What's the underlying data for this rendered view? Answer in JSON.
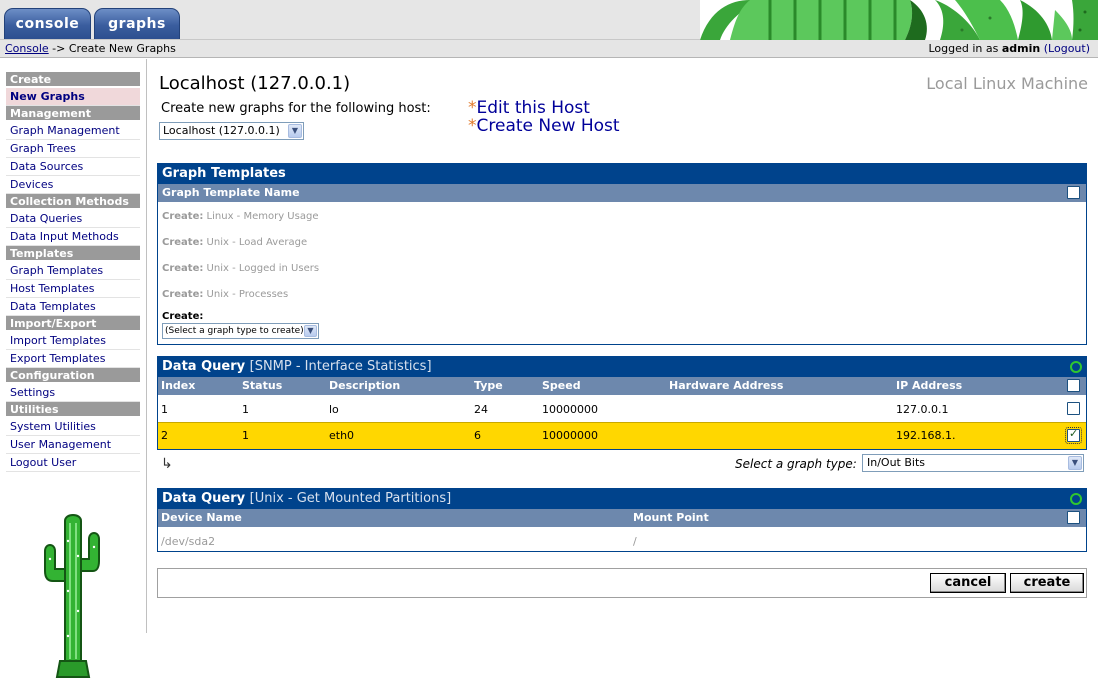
{
  "tabs": [
    {
      "label": "console"
    },
    {
      "label": "graphs"
    }
  ],
  "breadcrumb": {
    "root": "Console",
    "sep": " -> ",
    "current": "Create New Graphs"
  },
  "login": {
    "prefix": "Logged in as ",
    "user": "admin",
    "logout": "(Logout)"
  },
  "sidebar": {
    "sections": [
      {
        "head": "Create",
        "items": [
          "New Graphs"
        ]
      },
      {
        "head": "Management",
        "items": [
          "Graph Management",
          "Graph Trees",
          "Data Sources",
          "Devices"
        ]
      },
      {
        "head": "Collection Methods",
        "items": [
          "Data Queries",
          "Data Input Methods"
        ]
      },
      {
        "head": "Templates",
        "items": [
          "Graph Templates",
          "Host Templates",
          "Data Templates"
        ]
      },
      {
        "head": "Import/Export",
        "items": [
          "Import Templates",
          "Export Templates"
        ]
      },
      {
        "head": "Configuration",
        "items": [
          "Settings"
        ]
      },
      {
        "head": "Utilities",
        "items": [
          "System Utilities",
          "User Management",
          "Logout User"
        ]
      }
    ],
    "selected": "New Graphs"
  },
  "host": {
    "title": "Localhost (127.0.0.1)",
    "description": "Local Linux Machine",
    "create_label": "Create new graphs for the following host:",
    "selected": "Localhost (127.0.0.1)",
    "link_edit": "Edit this Host",
    "link_create": "Create New Host",
    "star": "*"
  },
  "graph_templates": {
    "title": "Graph Templates",
    "column": "Graph Template Name",
    "rows": [
      {
        "prefix": "Create:",
        "name": " Linux - Memory Usage"
      },
      {
        "prefix": "Create:",
        "name": " Unix - Load Average"
      },
      {
        "prefix": "Create:",
        "name": " Unix - Logged in Users"
      },
      {
        "prefix": "Create:",
        "name": " Unix - Processes"
      }
    ],
    "create_label": "Create:",
    "select_value": "(Select a graph type to create)"
  },
  "dq_snmp": {
    "title": "Data Query",
    "subtitle": "[SNMP - Interface Statistics]",
    "columns": [
      "Index",
      "Status",
      "Description",
      "Type",
      "Speed",
      "Hardware Address",
      "IP Address"
    ],
    "rows": [
      {
        "index": "1",
        "status": "1",
        "description": "lo",
        "type": "24",
        "speed": "10000000",
        "hw": "",
        "ip": "127.0.0.1",
        "checked": false
      },
      {
        "index": "2",
        "status": "1",
        "description": "eth0",
        "type": "6",
        "speed": "10000000",
        "hw": "",
        "ip": "192.168.1.",
        "checked": true
      }
    ],
    "graph_type_label": "Select a graph type:",
    "graph_type_value": "In/Out Bits"
  },
  "dq_unix": {
    "title": "Data Query",
    "subtitle": "[Unix - Get Mounted Partitions]",
    "columns": [
      "Device Name",
      "Mount Point"
    ],
    "rows": [
      {
        "device": "/dev/sda2",
        "mount": "/"
      }
    ]
  },
  "buttons": {
    "cancel": "cancel",
    "create": "create"
  },
  "colors": {
    "panel_header": "#00438c",
    "column_header": "#6d88ad",
    "selected_row": "#ffd700",
    "menu_head": "#9a9a9a"
  }
}
